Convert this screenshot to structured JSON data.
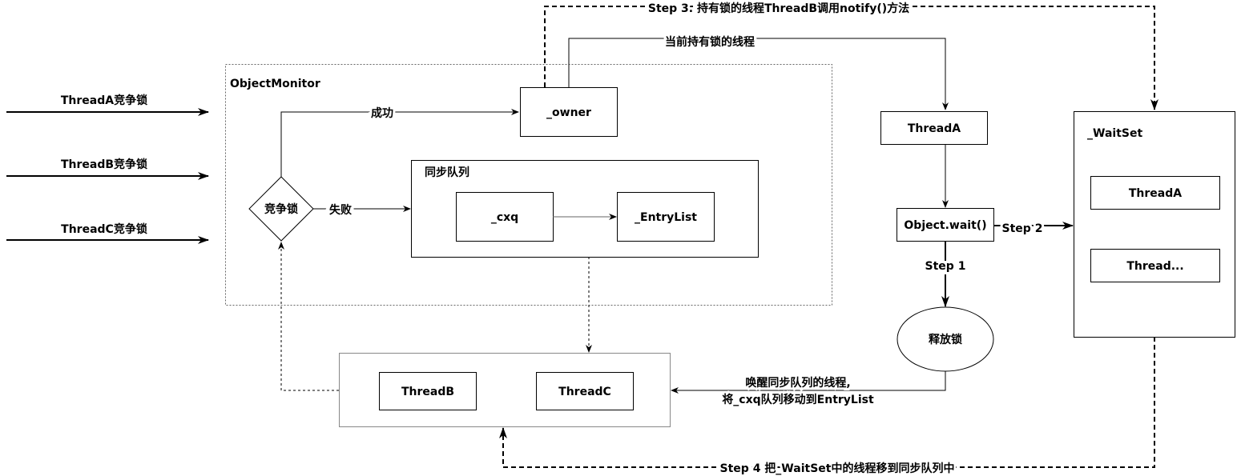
{
  "inputs": {
    "thread_a": "ThreadA竞争锁",
    "thread_b": "ThreadB竞争锁",
    "thread_c": "ThreadC竞争锁"
  },
  "monitor": {
    "title": "ObjectMonitor",
    "owner": "_owner",
    "decision": "竞争锁",
    "success": "成功",
    "failure": "失败",
    "sync_queue": {
      "title": "同步队列",
      "cxq": "_cxq",
      "entry_list": "_EntryList"
    }
  },
  "waiting_threads": [
    "ThreadB",
    "ThreadC"
  ],
  "current_owner_label": "当前持有锁的线程",
  "step3": "Step 3. 持有锁的线程ThreadB调用notify()方法",
  "thread_a": "ThreadA",
  "wait_call": "Object.wait()",
  "step1": "Step 1",
  "step2": "Step 2",
  "release": "释放锁",
  "wake_line1": "唤醒同步队列的线程,",
  "wake_line2": "将_cxq队列移动到EntryList",
  "waitset": {
    "title": "_WaitSet",
    "items": [
      "ThreadA",
      "Thread..."
    ]
  },
  "step4": "Step 4 把_WaitSet中的线程移到同步队列中"
}
